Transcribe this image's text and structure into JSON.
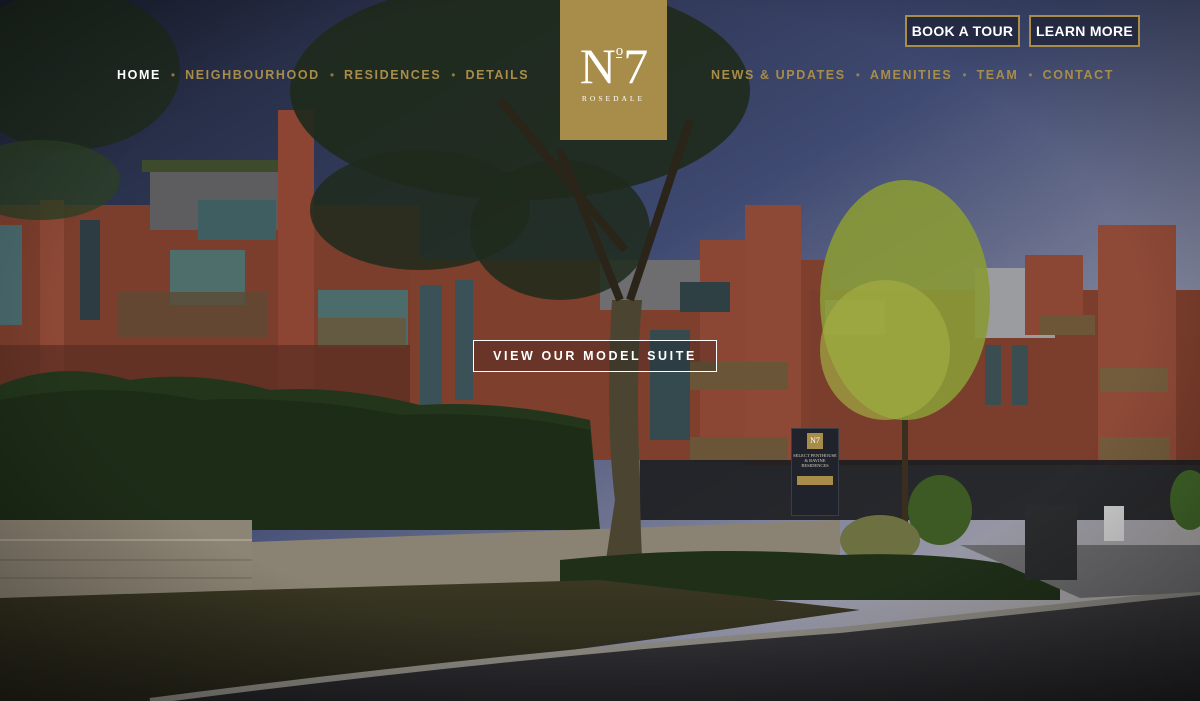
{
  "logo": {
    "number": "N",
    "sup": "o",
    "digit": "7",
    "subtitle": "ROSEDALE"
  },
  "nav": {
    "left": [
      {
        "label": "HOME",
        "active": true
      },
      {
        "label": "NEIGHBOURHOOD",
        "active": false
      },
      {
        "label": "RESIDENCES",
        "active": false
      },
      {
        "label": "DETAILS",
        "active": false
      }
    ],
    "right": [
      {
        "label": "NEWS & UPDATES",
        "active": false
      },
      {
        "label": "AMENITIES",
        "active": false
      },
      {
        "label": "TEAM",
        "active": false
      },
      {
        "label": "CONTACT",
        "active": false
      }
    ],
    "separator": "•"
  },
  "buttons": {
    "book_tour": "BOOK A TOUR",
    "learn_more": "LEARN MORE"
  },
  "hero": {
    "cta": "VIEW OUR MODEL SUITE"
  },
  "sign": {
    "logo": "N7",
    "text": "SELECT PENTHOUSE & RAVINE RESIDENCES"
  },
  "colors": {
    "gold": "#a88c4a",
    "white": "#ffffff",
    "sky_dark": "#1c2233"
  }
}
